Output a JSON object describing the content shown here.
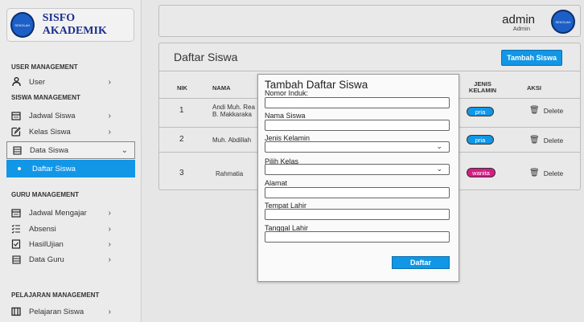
{
  "sidebar": {
    "brand_title": "SISFO AKADEMIK",
    "logo_text": "SEKOLAH",
    "sections": {
      "user": "USER MANAGEMENT",
      "siswa": "SISWA MANAGEMENT",
      "guru": "GURU MANAGEMENT",
      "pelajaran": "PELAJARAN MANAGEMENT"
    },
    "items": {
      "user": "User",
      "jadwal_siswa": "Jadwal Siswa",
      "kelas_siswa": "Kelas Siswa",
      "data_siswa": "Data Siswa",
      "daftar_siswa": "Daftar Siswa",
      "jadwal_mengajar": "Jadwal Mengajar",
      "absensi": "Absensi",
      "hasil_ujian": "HasilUjian",
      "data_guru": "Data Guru",
      "pelajaran_siswa": "Pelajaran Siswa"
    }
  },
  "topbar": {
    "admin_name": "admin",
    "admin_role": "Admin",
    "avatar_text": "SEKOLAH"
  },
  "main": {
    "title": "Daftar Siswa",
    "add_button": "Tambah Siswa",
    "columns": {
      "nik": "NIK",
      "nama": "NAMA",
      "jenis_kelamin": "JENIS KELAMIN",
      "aksi": "AKSI"
    },
    "rows": [
      {
        "nik": "1",
        "nama": "Andi Muh. Rea\nB. Makkaraka",
        "gender": "pria",
        "action": "Delete"
      },
      {
        "nik": "2",
        "nama": "Muh. Abdillah",
        "gender": "pria",
        "action": "Delete"
      },
      {
        "nik": "3",
        "nama": "Rahmatia",
        "gender": "wanita",
        "action": "Delete"
      }
    ]
  },
  "modal": {
    "title": "Tambah Daftar Siswa",
    "fields": {
      "nomor_induk": "Nomor Induk:",
      "nama_siswa": "Nama Siswa",
      "jenis_kelamin": "Jenis Kelamin",
      "pilih_kelas": "Pilih Kelas",
      "alamat": "Alamat",
      "tempat_lahir": "Tempat Lahir",
      "tanggal_lahir": "Tanggal Lahir"
    },
    "submit": "Daftar"
  },
  "colors": {
    "accent": "#1296e6",
    "brand": "#1a2f8a",
    "wanita": "#d81b86"
  }
}
